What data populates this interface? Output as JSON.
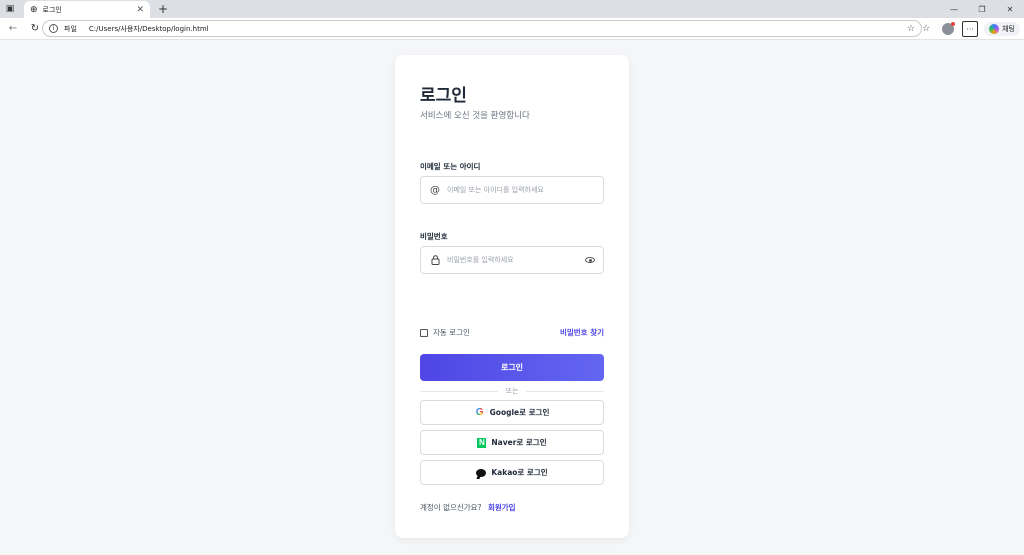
{
  "browser": {
    "tab_title": "로그인",
    "close_tab": "✕",
    "new_tab": "+",
    "address_label": "파일",
    "address_url": "C:/Users/사용자/Desktop/login.html",
    "copilot_label": "채팅"
  },
  "login": {
    "title": "로그인",
    "subtitle": "서비스에 오신 것을 환영합니다",
    "email_label": "이메일 또는 아이디",
    "email_placeholder": "이메일 또는 아이디를 입력하세요",
    "password_label": "비밀번호",
    "password_placeholder": "비밀번호를 입력하세요",
    "remember_label": "자동 로그인",
    "forgot_link": "비밀번호 찾기",
    "submit_label": "로그인",
    "divider_text": "또는",
    "google_label": "Google로 로그인",
    "naver_label": "Naver로 로그인",
    "kakao_label": "Kakao로 로그인",
    "signup_prompt": "계정이 없으신가요?",
    "signup_link": "회원가입"
  },
  "colors": {
    "accent": "#4f46e5",
    "page_bg": "#f5f6f8",
    "naver": "#03c75a",
    "kakao": "#111111"
  }
}
